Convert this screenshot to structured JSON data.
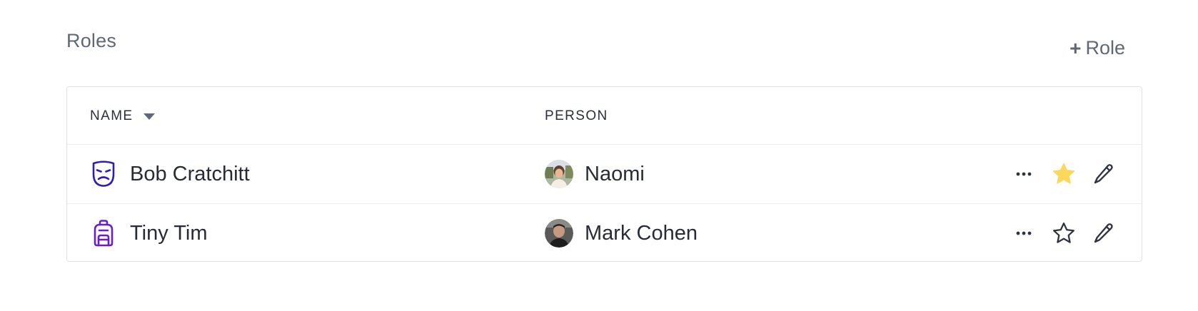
{
  "header": {
    "title": "Roles",
    "add_button_plus": "+",
    "add_button_label": "Role"
  },
  "table": {
    "columns": [
      {
        "label": "NAME",
        "sort": "descending"
      },
      {
        "label": "PERSON"
      }
    ],
    "rows": [
      {
        "role": "Bob Cratchitt",
        "role_icon": "theater-mask-sad-icon",
        "role_icon_color": "#2b1fb8",
        "person": "Naomi",
        "avatar": "avatar-naomi",
        "starred": true,
        "more_icon": "more-horizontal-icon",
        "star_icon": "star-filled-icon",
        "edit_icon": "pencil-icon"
      },
      {
        "role": "Tiny Tim",
        "role_icon": "backpack-icon",
        "role_icon_color": "#6b1ec4",
        "person": "Mark Cohen",
        "avatar": "avatar-mark-cohen",
        "starred": false,
        "more_icon": "more-horizontal-icon",
        "star_icon": "star-outline-icon",
        "edit_icon": "pencil-icon"
      }
    ]
  },
  "colors": {
    "muted_text": "#5f6876",
    "body_text": "#262b36",
    "border": "#dfe2e7",
    "star_filled": "#fbd75b",
    "icon_stroke": "#2f3441"
  }
}
